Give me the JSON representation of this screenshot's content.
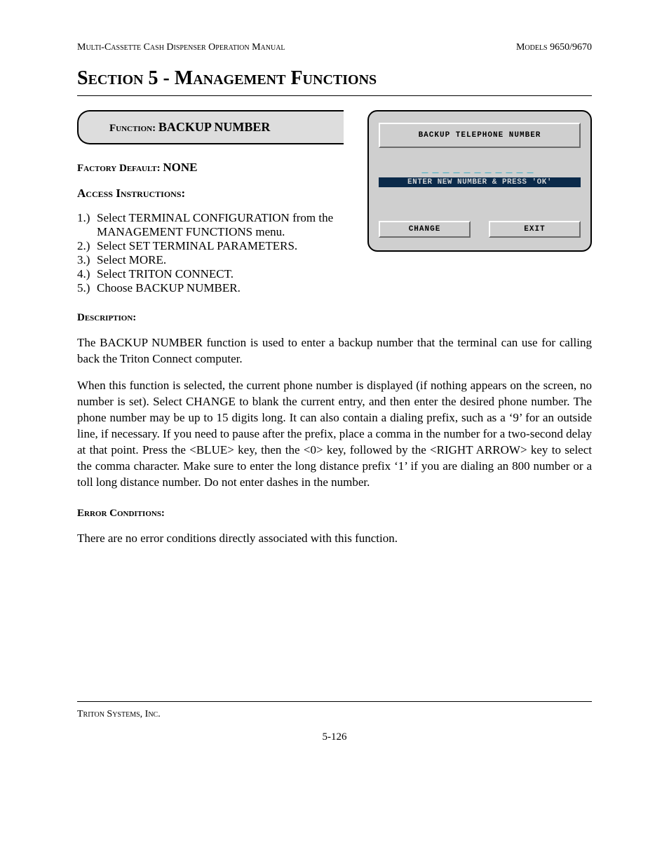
{
  "header": {
    "left": "Multi-Cassette Cash Dispenser Operation Manual",
    "right": "Models 9650/9670"
  },
  "section_title": "Section 5 - Management Functions",
  "function_banner": {
    "label": "Function:  ",
    "value": "BACKUP NUMBER"
  },
  "factory_default": {
    "label": "Factory Default: ",
    "value": "NONE"
  },
  "access_instructions_label": "Access Instructions:",
  "steps": [
    "Select TERMINAL CONFIGURATION from the MANAGEMENT FUNCTIONS menu.",
    "Select SET TERMINAL PARAMETERS.",
    "Select MORE.",
    "Select TRITON CONNECT.",
    "Choose BACKUP NUMBER."
  ],
  "description_label": "Description:",
  "description_paras": [
    "The BACKUP NUMBER function is used to enter a backup number that the terminal can use for calling back the Triton Connect computer.",
    "When this function is selected, the current phone number is displayed (if nothing appears on the screen, no number is set).  Select CHANGE to blank the current entry, and then enter the desired phone number.  The phone number may be up to 15 digits long.  It can also contain a dialing prefix, such as a ‘9’ for an outside line, if necessary.  If you need to pause after the prefix, place a comma in the number for a two-second delay at that point.  Press the <BLUE> key, then the <0> key, followed by the <RIGHT ARROW> key to select the comma character.  Make sure to enter the long distance prefix ‘1’ if you are dialing an 800 number or a toll long distance number.  Do not enter dashes in the number."
  ],
  "error_conditions_label": "Error Conditions:",
  "error_conditions_text": "There are no error conditions directly associated with this function.",
  "terminal": {
    "title": "BACKUP TELEPHONE NUMBER",
    "input_placeholder": "___________",
    "instruction": "ENTER NEW NUMBER & PRESS 'OK'",
    "btn_change": "CHANGE",
    "btn_exit": "EXIT"
  },
  "footer": {
    "company": "Triton Systems, Inc.",
    "page": "5-126"
  }
}
